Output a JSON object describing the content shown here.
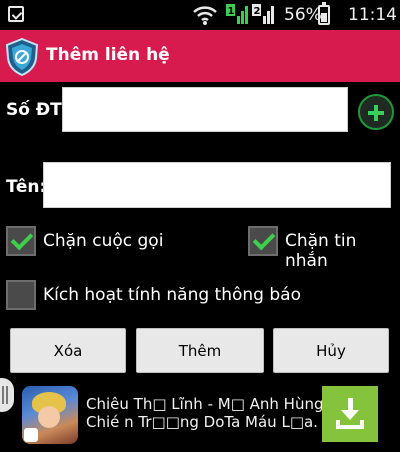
{
  "status_bar": {
    "battery_percent": "56%",
    "time": "11:14",
    "sim1": "1",
    "sim2": "2",
    "icons": [
      "notification-icon",
      "wifi-icon",
      "sim1-signal-icon",
      "sim2-signal-icon",
      "battery-icon"
    ]
  },
  "action_bar": {
    "title": "Thêm liên hệ",
    "icon": "shield-icon",
    "color": "#d81b4e"
  },
  "form": {
    "phone_label": "Số ĐT:",
    "phone_value": "",
    "name_label": "Tên:",
    "name_value": "",
    "add_contact_icon": "plus-circle-icon"
  },
  "options": {
    "block_calls": {
      "label": "Chặn cuộc gọi",
      "checked": true
    },
    "block_sms": {
      "label": "Chặn tin nhắn",
      "checked": true
    },
    "notify": {
      "label": "Kích hoạt tính năng thông báo",
      "checked": false
    }
  },
  "buttons": {
    "delete": "Xóa",
    "add": "Thêm",
    "cancel": "Hủy"
  },
  "ad": {
    "line1": "Chiêu Th□ Lĩnh - M□ Anh Hùng.",
    "line2": "Chié n Tr□□ng DoTa Máu L□a.",
    "download_icon": "download-icon",
    "accent": "#86c33c"
  }
}
